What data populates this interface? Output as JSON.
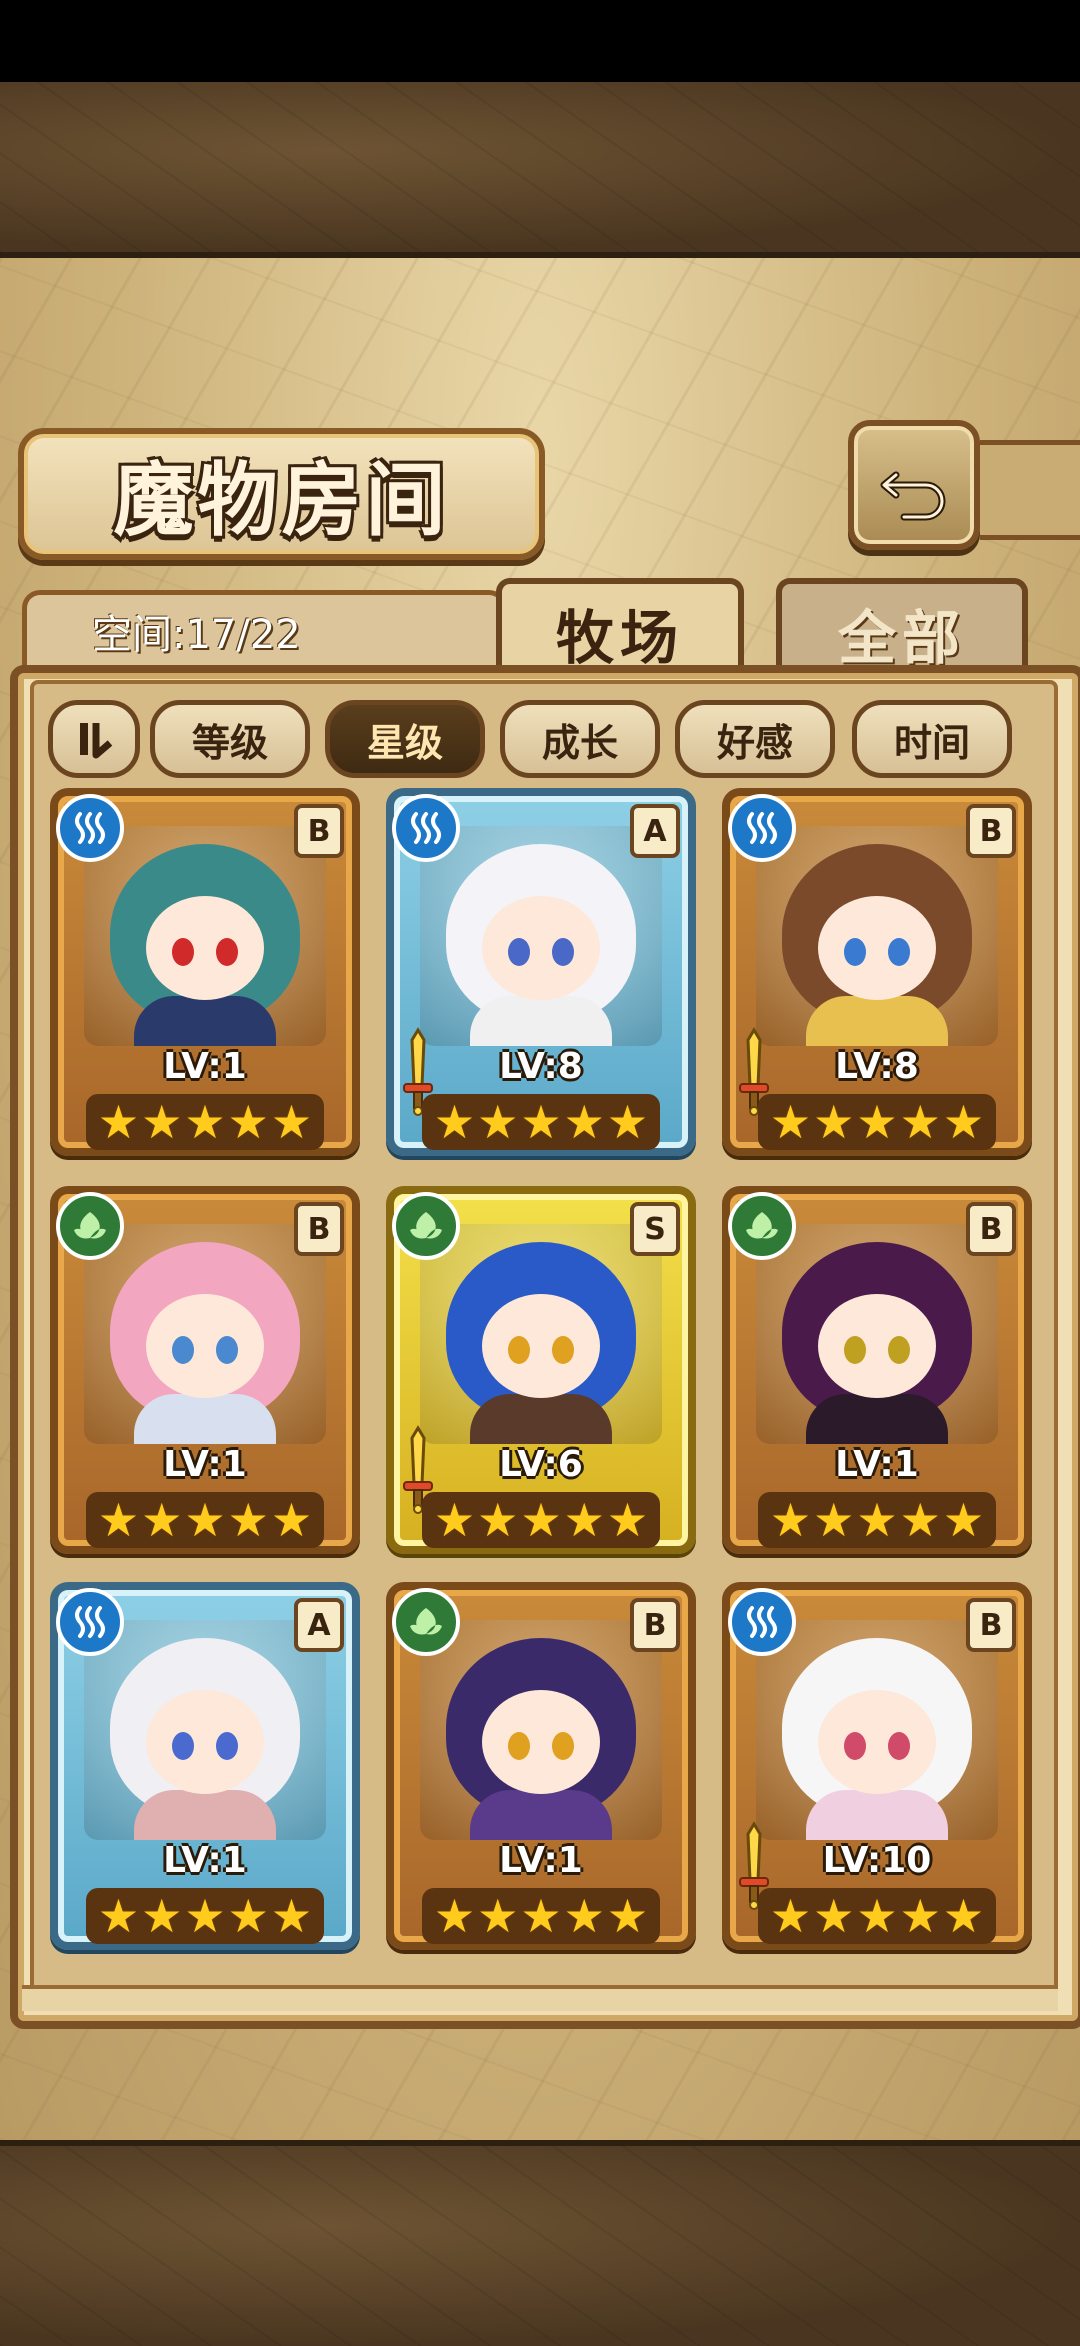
{
  "header": {
    "title": "魔物房间",
    "back_icon": "back-arrow-icon"
  },
  "space": {
    "label": "空间:17/22"
  },
  "tabs": [
    {
      "label": "牧场",
      "active": true
    },
    {
      "label": "全部",
      "active": false
    }
  ],
  "sort": {
    "toggle_icon": "sort-order-icon",
    "buttons": [
      {
        "label": "等级",
        "active": false
      },
      {
        "label": "星级",
        "active": true
      },
      {
        "label": "成长",
        "active": false
      },
      {
        "label": "好感",
        "active": false
      },
      {
        "label": "时间",
        "active": false
      }
    ]
  },
  "monsters": [
    {
      "element": "water",
      "rarity": "B",
      "level": "LV:1",
      "stars": 5,
      "has_weapon": false,
      "hair": "#3a8a8a",
      "eye": "#d02a2a",
      "body": "#2a3a6a"
    },
    {
      "element": "water",
      "rarity": "A",
      "level": "LV:8",
      "stars": 5,
      "has_weapon": true,
      "hair": "#f4f4f8",
      "eye": "#4a68c8",
      "body": "#f0f0f0"
    },
    {
      "element": "water",
      "rarity": "B",
      "level": "LV:8",
      "stars": 5,
      "has_weapon": true,
      "hair": "#7a4a2a",
      "eye": "#3a7ad0",
      "body": "#e8c050"
    },
    {
      "element": "grass",
      "rarity": "B",
      "level": "LV:1",
      "stars": 5,
      "has_weapon": false,
      "hair": "#f2a6c0",
      "eye": "#4a88d0",
      "body": "#d8e0f0"
    },
    {
      "element": "grass",
      "rarity": "S",
      "level": "LV:6",
      "stars": 5,
      "has_weapon": true,
      "hair": "#2a5ac8",
      "eye": "#e0a020",
      "body": "#5a3a2a"
    },
    {
      "element": "grass",
      "rarity": "B",
      "level": "LV:1",
      "stars": 5,
      "has_weapon": false,
      "hair": "#4a1a4a",
      "eye": "#c0a020",
      "body": "#2a1a2a"
    },
    {
      "element": "water",
      "rarity": "A",
      "level": "LV:1",
      "stars": 5,
      "has_weapon": false,
      "hair": "#f0f0f4",
      "eye": "#4a6ad0",
      "body": "#e0b0b0"
    },
    {
      "element": "grass",
      "rarity": "B",
      "level": "LV:1",
      "stars": 5,
      "has_weapon": false,
      "hair": "#3a2a6a",
      "eye": "#e0a020",
      "body": "#5a3a8a"
    },
    {
      "element": "water",
      "rarity": "B",
      "level": "LV:10",
      "stars": 5,
      "has_weapon": true,
      "hair": "#f6f6f6",
      "eye": "#d04a6a",
      "body": "#f0d0e0"
    }
  ],
  "colors": {
    "water_element": "#1e78c8",
    "grass_element": "#2e7a36",
    "star": "#ffcc1e"
  }
}
